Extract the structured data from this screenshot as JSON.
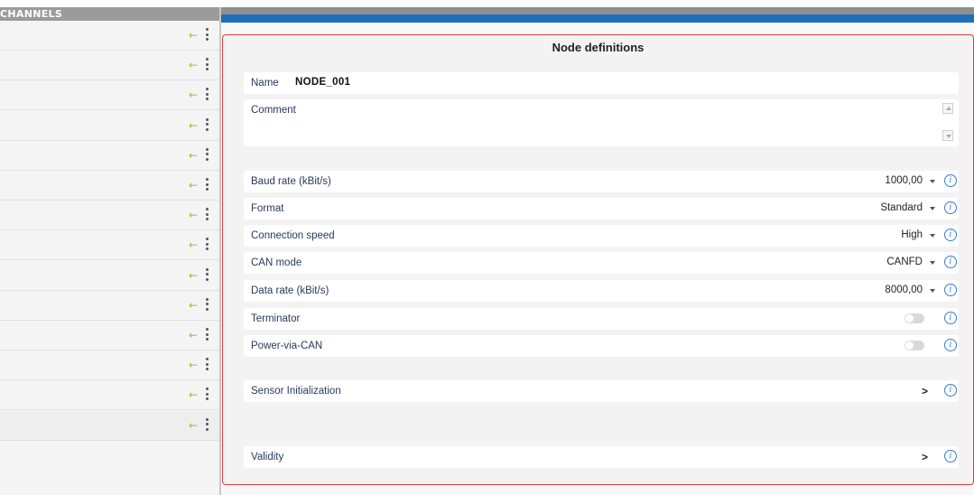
{
  "sidebar": {
    "header": "CHANNELS",
    "row_count": 14,
    "arrow_glyph": "←",
    "arrow_color": "#8dc63f"
  },
  "node": {
    "title": "Node definitions",
    "name_label": "Name",
    "name_value": "NODE_001",
    "comment_label": "Comment",
    "fields": {
      "baud_rate": {
        "label": "Baud rate (kBit/s)",
        "value": "1000,00"
      },
      "format": {
        "label": "Format",
        "value": "Standard"
      },
      "connection_speed": {
        "label": "Connection speed",
        "value": "High"
      },
      "can_mode": {
        "label": "CAN mode",
        "value": "CANFD"
      },
      "data_rate": {
        "label": "Data rate (kBit/s)",
        "value": "8000,00"
      },
      "terminator": {
        "label": "Terminator",
        "on": false
      },
      "power_via_can": {
        "label": "Power-via-CAN",
        "on": false
      }
    },
    "sensor_init_label": "Sensor Initialization",
    "validity_label": "Validity",
    "info_glyph": "i",
    "chevron_glyph": ">"
  },
  "colors": {
    "accent_blue": "#1f6fb8",
    "highlight_border": "#e03c3c",
    "info_blue": "#3a7bd5"
  }
}
